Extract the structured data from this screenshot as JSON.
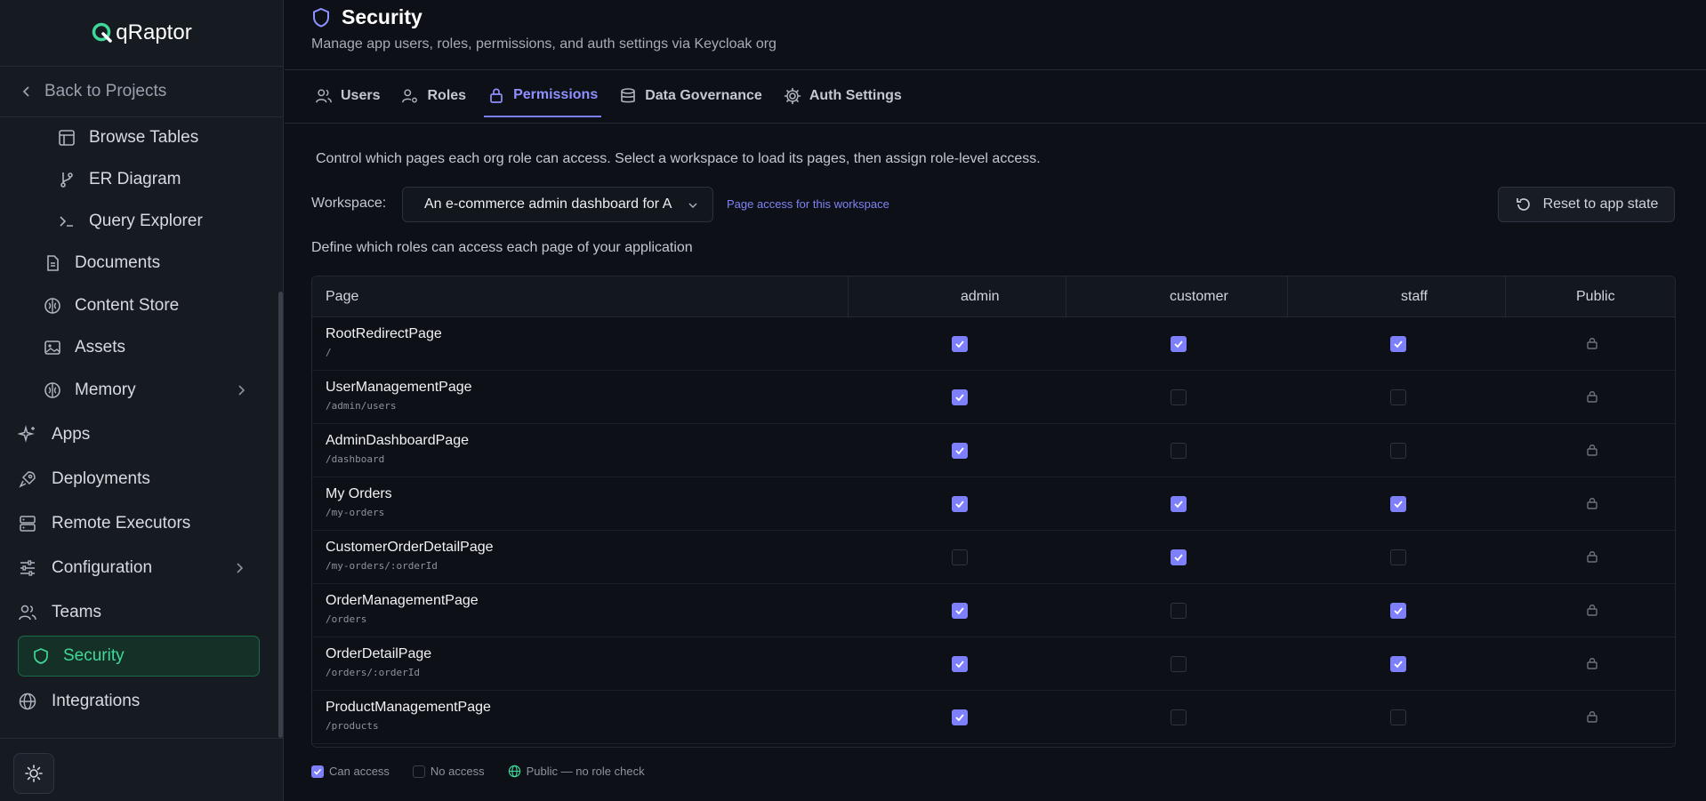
{
  "app": {
    "logo_text": "qRaptor",
    "back_label": "Back to Projects"
  },
  "sidebar": {
    "items": [
      {
        "label": "Browse Tables",
        "icon": "table-icon",
        "sub": true
      },
      {
        "label": "ER Diagram",
        "icon": "git-branch-icon",
        "sub": true
      },
      {
        "label": "Query Explorer",
        "icon": "terminal-icon",
        "sub": true
      },
      {
        "label": "Documents",
        "icon": "document-icon",
        "sub": false
      },
      {
        "label": "Content Store",
        "icon": "brain-icon",
        "sub": false
      },
      {
        "label": "Assets",
        "icon": "image-icon",
        "sub": false
      },
      {
        "label": "Memory",
        "icon": "brain-icon",
        "sub": false,
        "chevron": true
      },
      {
        "label": "Apps",
        "icon": "sparkle-icon",
        "sub": false
      },
      {
        "label": "Deployments",
        "icon": "rocket-icon",
        "sub": false
      },
      {
        "label": "Remote Executors",
        "icon": "server-icon",
        "sub": false
      },
      {
        "label": "Configuration",
        "icon": "sliders-icon",
        "sub": false,
        "chevron": true
      },
      {
        "label": "Teams",
        "icon": "users-icon",
        "sub": false
      },
      {
        "label": "Security",
        "icon": "shield-icon",
        "sub": false,
        "active": true
      },
      {
        "label": "Integrations",
        "icon": "globe-icon",
        "sub": false
      }
    ]
  },
  "header": {
    "title": "Security",
    "subtitle": "Manage app users, roles, permissions, and auth settings via Keycloak org"
  },
  "tabs": [
    {
      "label": "Users",
      "icon": "users-icon"
    },
    {
      "label": "Roles",
      "icon": "user-key-icon"
    },
    {
      "label": "Permissions",
      "icon": "lock-icon",
      "active": true
    },
    {
      "label": "Data Governance",
      "icon": "database-icon"
    },
    {
      "label": "Auth Settings",
      "icon": "gear-icon"
    }
  ],
  "permissions": {
    "intro": "Control which pages each org role can access. Select a workspace to load its pages, then assign role-level access.",
    "workspace_label": "Workspace:",
    "workspace_value": "An e-commerce admin dashboard for A",
    "workspace_link": "Page access for this workspace",
    "reset_label": "Reset to app state",
    "define_text": "Define which roles can access each page of your application",
    "columns": {
      "page": "Page",
      "admin": "admin",
      "customer": "customer",
      "staff": "staff",
      "public": "Public"
    },
    "rows": [
      {
        "name": "RootRedirectPage",
        "path": "/",
        "admin": true,
        "customer": true,
        "staff": true
      },
      {
        "name": "UserManagementPage",
        "path": "/admin/users",
        "admin": true,
        "customer": false,
        "staff": false
      },
      {
        "name": "AdminDashboardPage",
        "path": "/dashboard",
        "admin": true,
        "customer": false,
        "staff": false
      },
      {
        "name": "My Orders",
        "path": "/my-orders",
        "admin": true,
        "customer": true,
        "staff": true
      },
      {
        "name": "CustomerOrderDetailPage",
        "path": "/my-orders/:orderId",
        "admin": false,
        "customer": true,
        "staff": false
      },
      {
        "name": "OrderManagementPage",
        "path": "/orders",
        "admin": true,
        "customer": false,
        "staff": true
      },
      {
        "name": "OrderDetailPage",
        "path": "/orders/:orderId",
        "admin": true,
        "customer": false,
        "staff": true
      },
      {
        "name": "ProductManagementPage",
        "path": "/products",
        "admin": true,
        "customer": false,
        "staff": false
      }
    ],
    "legend": {
      "can": "Can access",
      "no": "No access",
      "public": "Public — no role check"
    }
  },
  "colors": {
    "accent": "#7d80fa",
    "active_green": "#3fd89a",
    "background": "#0d1016"
  }
}
